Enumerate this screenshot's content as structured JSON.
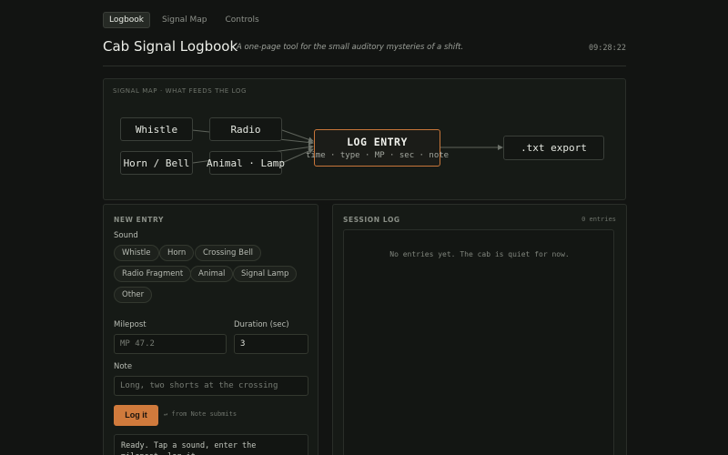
{
  "nav": {
    "tabs": [
      {
        "label": "Logbook",
        "active": true
      },
      {
        "label": "Signal Map",
        "active": false
      },
      {
        "label": "Controls",
        "active": false
      }
    ]
  },
  "header": {
    "title": "Cab Signal Logbook",
    "subtitle": "A one-page tool for the small auditory mysteries of a shift.",
    "clock": "09:28:22"
  },
  "signal_map": {
    "label": "SIGNAL MAP · WHAT FEEDS THE LOG",
    "nodes": {
      "whistle": "Whistle",
      "radio": "Radio",
      "horn_bell": "Horn / Bell",
      "animal_lamp": "Animal · Lamp",
      "log_entry": "LOG ENTRY",
      "log_entry_fields": "time · type · MP · sec · note",
      "export": ".txt export"
    }
  },
  "new_entry": {
    "label": "NEW ENTRY",
    "sound_label": "Sound",
    "sounds": [
      "Whistle",
      "Horn",
      "Crossing Bell",
      "Radio Fragment",
      "Animal",
      "Signal Lamp",
      "Other"
    ],
    "milepost_label": "Milepost",
    "milepost_placeholder": "MP 47.2",
    "duration_label": "Duration (sec)",
    "duration_value": "3",
    "note_label": "Note",
    "note_placeholder": "Long, two shorts at the crossing",
    "log_button": "Log it",
    "submit_hint": "↵ from Note submits",
    "status_text": "Ready. Tap a sound, enter the milepost, log it."
  },
  "session_log": {
    "label": "SESSION LOG",
    "count": "0 entries",
    "empty_message": "No entries yet. The cab is quiet for now."
  },
  "colors": {
    "accent": "#d07a3c",
    "background": "#121412",
    "panel": "#161a16"
  }
}
